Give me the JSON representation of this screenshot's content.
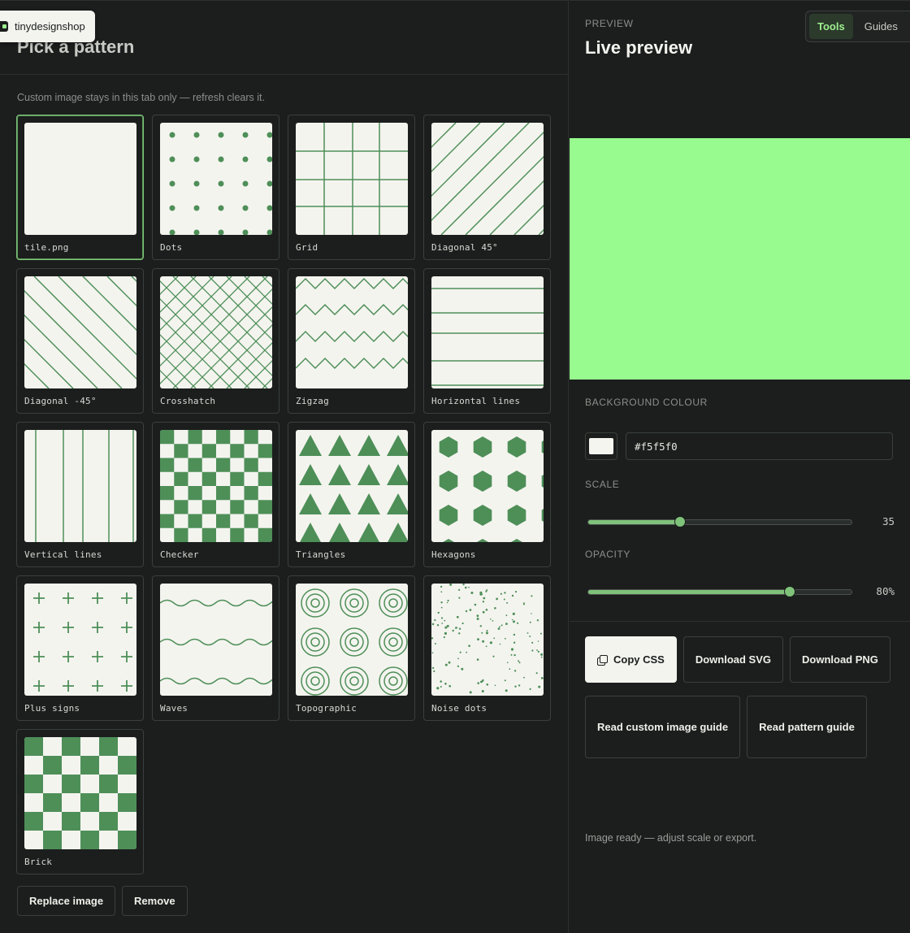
{
  "brand": {
    "name": "tinydesignshop"
  },
  "left": {
    "title": "Pick a pattern",
    "note": "Custom image stays in this tab only — refresh clears it.",
    "patterns": [
      {
        "id": "custom",
        "label": "tile.png",
        "selected": true
      },
      {
        "id": "dots",
        "label": "Dots"
      },
      {
        "id": "grid",
        "label": "Grid"
      },
      {
        "id": "diag45",
        "label": "Diagonal 45°"
      },
      {
        "id": "diagm45",
        "label": "Diagonal -45°"
      },
      {
        "id": "crosshatch",
        "label": "Crosshatch"
      },
      {
        "id": "zigzag",
        "label": "Zigzag"
      },
      {
        "id": "hlines",
        "label": "Horizontal lines"
      },
      {
        "id": "vlines",
        "label": "Vertical lines"
      },
      {
        "id": "checker",
        "label": "Checker"
      },
      {
        "id": "triangles",
        "label": "Triangles"
      },
      {
        "id": "hexagons",
        "label": "Hexagons"
      },
      {
        "id": "plus",
        "label": "Plus signs"
      },
      {
        "id": "waves",
        "label": "Waves"
      },
      {
        "id": "topo",
        "label": "Topographic"
      },
      {
        "id": "noise",
        "label": "Noise dots"
      },
      {
        "id": "brick",
        "label": "Brick"
      }
    ],
    "replace_label": "Replace image",
    "remove_label": "Remove"
  },
  "right": {
    "eyebrow": "PREVIEW",
    "title": "Live preview",
    "nav": {
      "tabs": [
        "Tools",
        "Guides"
      ],
      "active": "Tools"
    },
    "preview_color": "#98fb8f",
    "background": {
      "label": "BACKGROUND COLOUR",
      "value": "#f5f5f0"
    },
    "scale": {
      "label": "SCALE",
      "value": 35,
      "display": "35",
      "fraction": 0.35
    },
    "opacity": {
      "label": "OPACITY",
      "value": 80,
      "display": "80%",
      "fraction": 0.763
    },
    "actions": {
      "copy_css": "Copy CSS",
      "download_svg": "Download SVG",
      "download_png": "Download PNG",
      "read_custom": "Read custom image guide",
      "read_pattern": "Read pattern guide"
    },
    "status": "Image ready — adjust scale or export."
  },
  "colors": {
    "accent": "#4e8f58",
    "tile_bg": "#f4f4ef",
    "panel_bg": "#1b1e1d"
  }
}
